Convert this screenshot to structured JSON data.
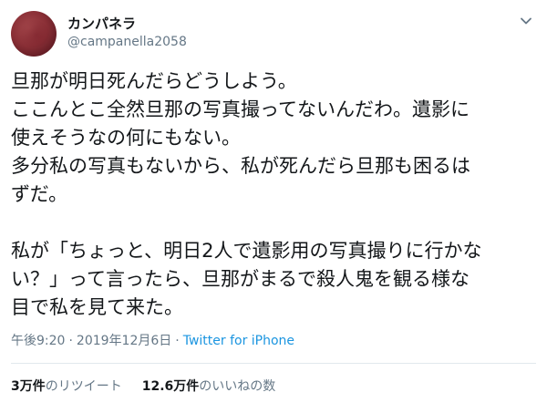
{
  "user": {
    "display_name": "カンパネラ",
    "handle": "@campanella2058",
    "avatar_color": "#8a2f36"
  },
  "tweet": {
    "text": "旦那が明日死んだらどうしよう。\nここんとこ全然旦那の写真撮ってないんだわ。遺影に\n使えそうなの何にもない。\n多分私の写真もないから、私が死んだら旦那も困るは\nずだ。\n\n私が「ちょっと、明日2人で遺影用の写真撮りに行かな\nい？」って言ったら、旦那がまるで殺人鬼を観る様な\n目で私を見て来た。",
    "time": "午後9:20",
    "date": "2019年12月6日",
    "separator1": "·",
    "separator2": "·",
    "source": "Twitter for iPhone"
  },
  "stats": {
    "retweets_count": "3万件",
    "retweets_label": "のリツイート",
    "likes_count": "12.6万件",
    "likes_label": "のいいねの数"
  },
  "icons": {
    "menu": "chevron-down-icon"
  },
  "colors": {
    "text": "#14171a",
    "secondary": "#657786",
    "link": "#1b95e0",
    "divider": "#e1e8ed"
  }
}
